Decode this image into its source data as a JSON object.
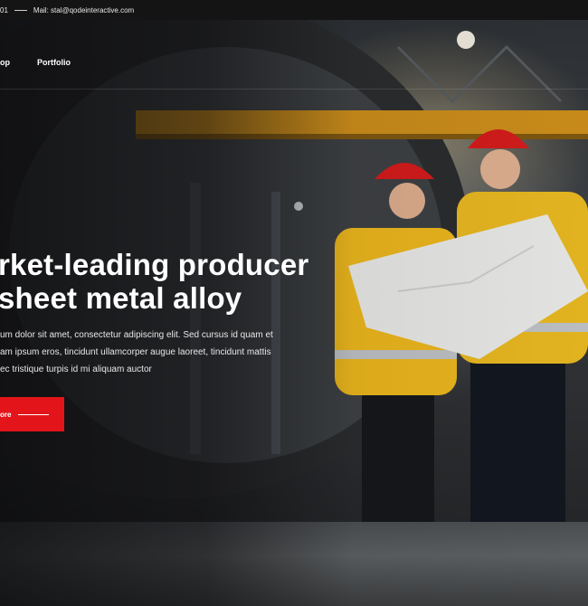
{
  "topbar": {
    "phone_tail": "01",
    "email": "Mail: stal@qodeinteractive.com"
  },
  "nav": {
    "items": [
      {
        "label": "op"
      },
      {
        "label": "Portfolio"
      }
    ]
  },
  "hero": {
    "headline_line1": "rket-leading producer",
    "headline_line2": "sheet metal alloy",
    "body_lines": [
      "um dolor sit amet, consectetur adipiscing elit. Sed cursus id quam et",
      "am ipsum eros, tincidunt ullamcorper augue laoreet, tincidunt mattis",
      "ec tristique turpis id mi aliquam auctor"
    ],
    "cta_label": "ore"
  },
  "colors": {
    "accent": "#e3151a",
    "topbar_bg": "#141414"
  }
}
